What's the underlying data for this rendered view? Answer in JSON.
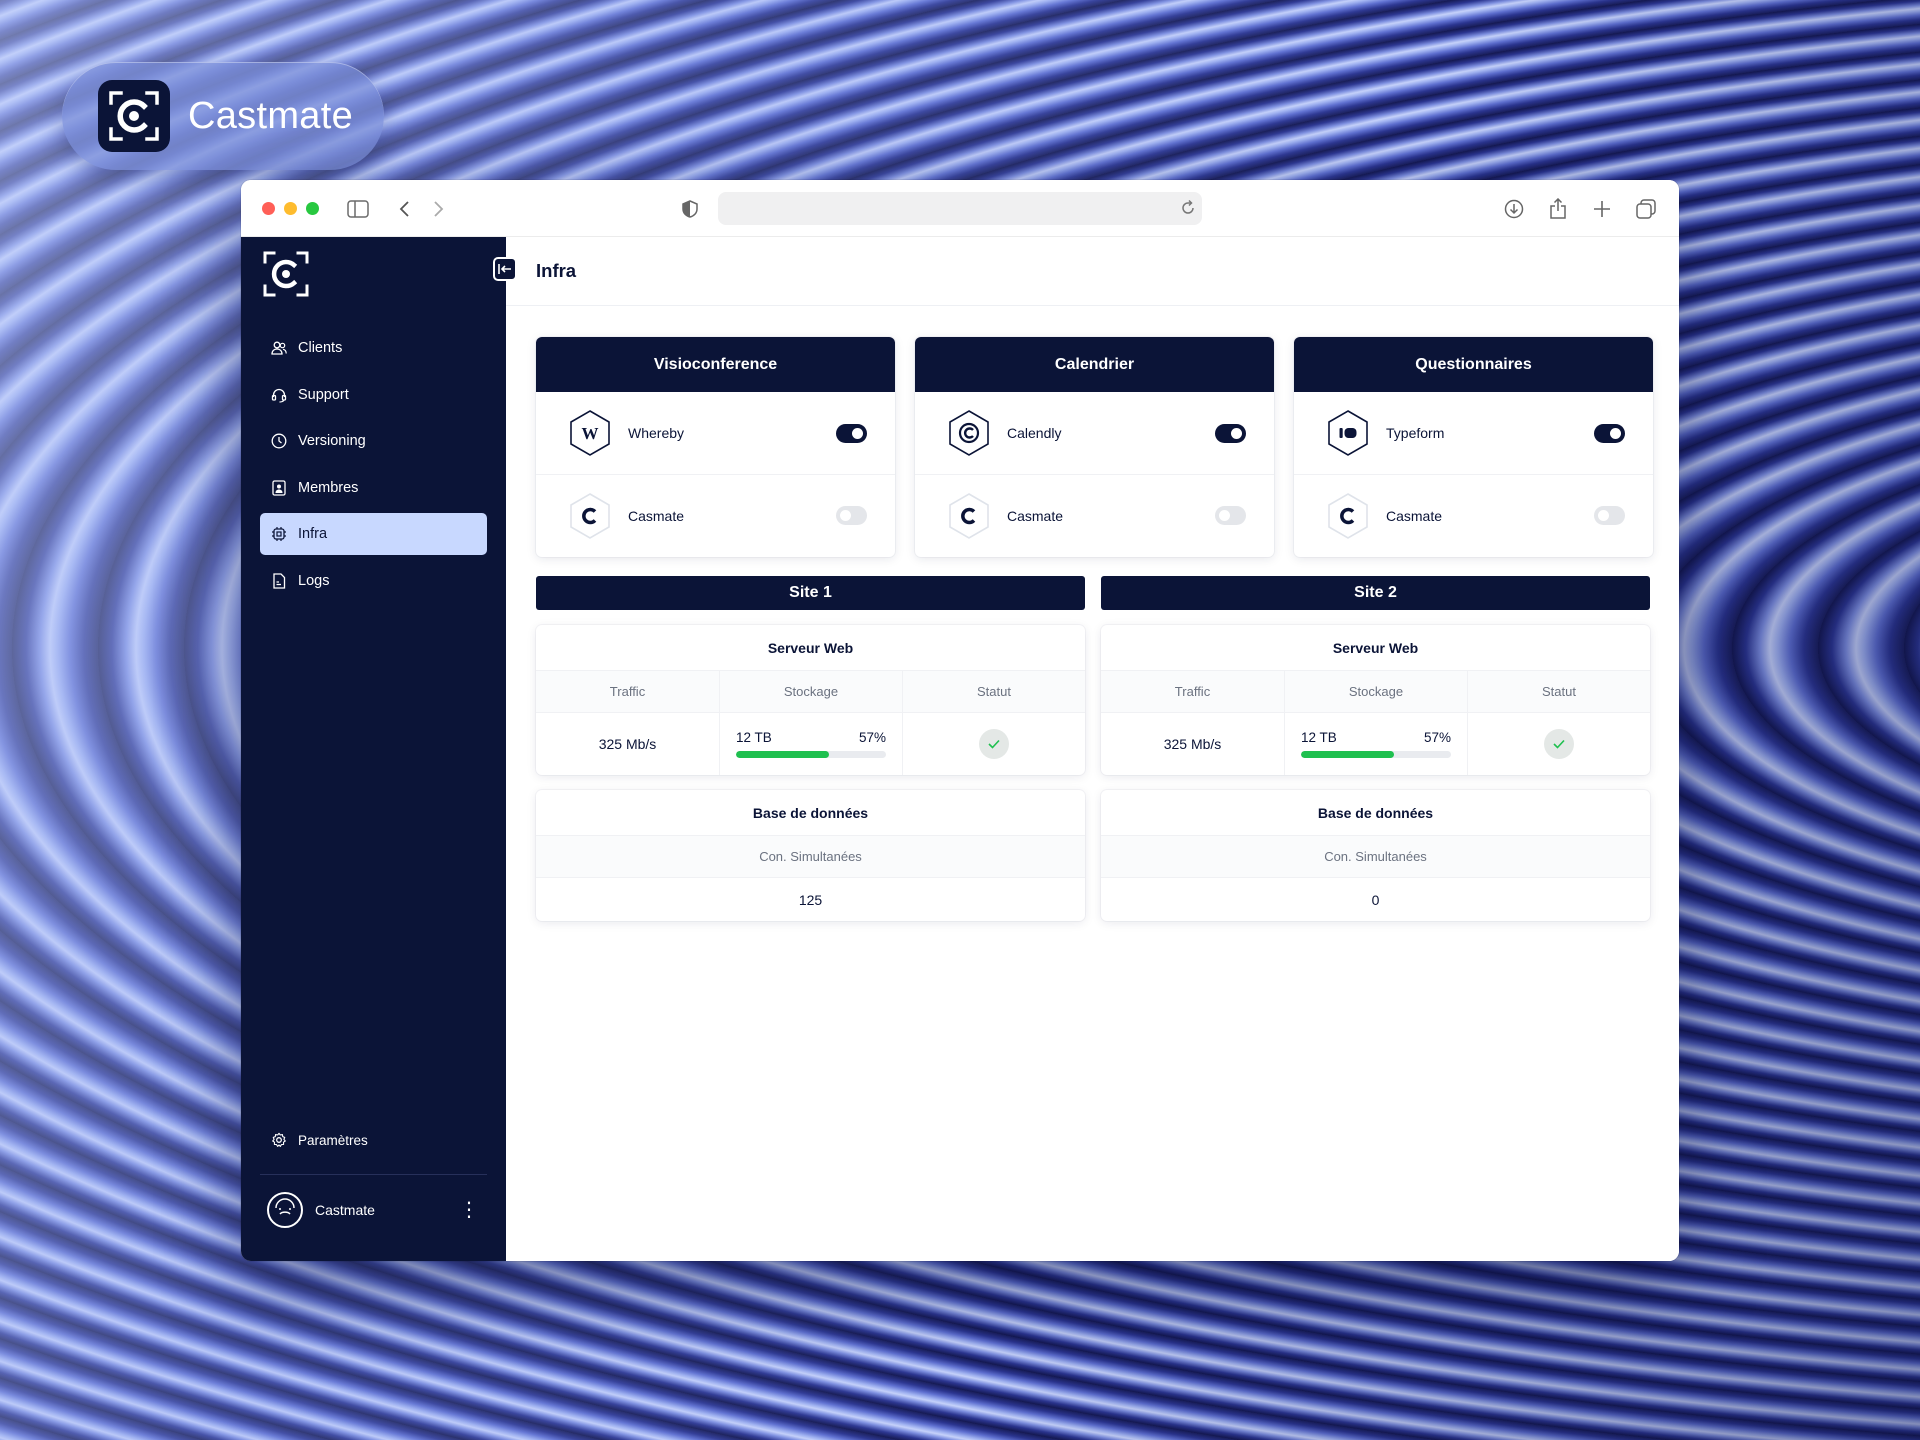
{
  "brand": {
    "name": "Castmate"
  },
  "sidebar": {
    "items": [
      {
        "label": "Clients",
        "icon": "users-icon",
        "active": false
      },
      {
        "label": "Support",
        "icon": "headset-icon",
        "active": false
      },
      {
        "label": "Versioning",
        "icon": "clock-icon",
        "active": false
      },
      {
        "label": "Membres",
        "icon": "badge-icon",
        "active": false
      },
      {
        "label": "Infra",
        "icon": "chip-icon",
        "active": true
      },
      {
        "label": "Logs",
        "icon": "file-icon",
        "active": false
      }
    ],
    "settings_label": "Paramètres",
    "user_name": "Castmate"
  },
  "page": {
    "title": "Infra"
  },
  "categories": [
    {
      "title": "Visioconference",
      "providers": [
        {
          "name": "Whereby",
          "enabled": true
        },
        {
          "name": "Casmate",
          "enabled": false
        }
      ]
    },
    {
      "title": "Calendrier",
      "providers": [
        {
          "name": "Calendly",
          "enabled": true
        },
        {
          "name": "Casmate",
          "enabled": false
        }
      ]
    },
    {
      "title": "Questionnaires",
      "providers": [
        {
          "name": "Typeform",
          "enabled": true
        },
        {
          "name": "Casmate",
          "enabled": false
        }
      ]
    }
  ],
  "sites": [
    {
      "title": "Site 1",
      "web": {
        "title": "Serveur Web",
        "headers": [
          "Traffic",
          "Stockage",
          "Statut"
        ],
        "traffic": "325 Mb/s",
        "storage": "12 TB",
        "storage_pct": "57%",
        "storage_fraction": 0.62,
        "status": "ok"
      },
      "db": {
        "title": "Base de données",
        "header": "Con. Simultanées",
        "value": "125"
      }
    },
    {
      "title": "Site 2",
      "web": {
        "title": "Serveur Web",
        "headers": [
          "Traffic",
          "Stockage",
          "Statut"
        ],
        "traffic": "325 Mb/s",
        "storage": "12 TB",
        "storage_pct": "57%",
        "storage_fraction": 0.62,
        "status": "ok"
      },
      "db": {
        "title": "Base de données",
        "header": "Con. Simultanées",
        "value": "0"
      }
    }
  ],
  "colors": {
    "navy": "#0b1437",
    "active_bg": "#c8d8ff",
    "progress": "#1fc04f"
  }
}
